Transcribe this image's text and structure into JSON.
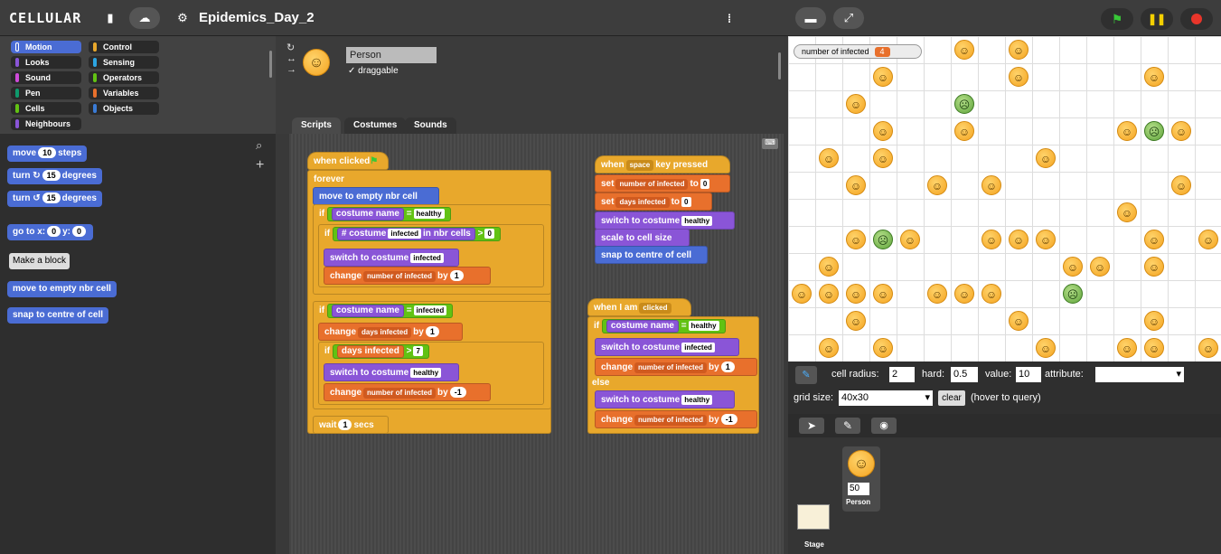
{
  "app": {
    "logo": "CELLULAR",
    "project_title": "Epidemics_Day_2"
  },
  "categories": [
    {
      "label": "Motion",
      "color": "#4a6cd4",
      "selected": true
    },
    {
      "label": "Control",
      "color": "#e8a82c"
    },
    {
      "label": "Looks",
      "color": "#8a55d7"
    },
    {
      "label": "Sensing",
      "color": "#2ca5e2"
    },
    {
      "label": "Sound",
      "color": "#cf4ad9"
    },
    {
      "label": "Operators",
      "color": "#62c213"
    },
    {
      "label": "Pen",
      "color": "#0e9a6c"
    },
    {
      "label": "Variables",
      "color": "#e8702c"
    },
    {
      "label": "Cells",
      "color": "#62c213"
    },
    {
      "label": "Objects",
      "color": "#3a7bd5"
    },
    {
      "label": "Neighbours",
      "color": "#8a55d7"
    }
  ],
  "palette": {
    "move": {
      "a": "move",
      "n": "10",
      "b": "steps"
    },
    "turn_cw": {
      "a": "turn ↻",
      "n": "15",
      "b": "degrees"
    },
    "turn_ccw": {
      "a": "turn ↺",
      "n": "15",
      "b": "degrees"
    },
    "goto": {
      "a": "go to x:",
      "x": "0",
      "b": "y:",
      "y": "0"
    },
    "make_block": "Make a block",
    "move_empty": "move to empty nbr cell",
    "snap": "snap to centre of cell"
  },
  "sprite": {
    "name": "Person",
    "draggable_label": "draggable",
    "draggable_checked": "✓"
  },
  "tabs": {
    "scripts": "Scripts",
    "costumes": "Costumes",
    "sounds": "Sounds"
  },
  "script1": {
    "hat": "when clicked",
    "forever": "forever",
    "move": "move to empty nbr cell",
    "if1": "if",
    "costume_name": "costume name",
    "eq": "=",
    "healthy": "healthy",
    "if2": "if",
    "count": "# costume",
    "infected": "infected",
    "in_nbr": "in nbr cells",
    "gt": ">",
    "zero": "0",
    "switch1": "switch to costume",
    "switch1_val": "infected",
    "change1": "change",
    "change1_var": "number of infected",
    "by": "by",
    "change1_val": "1",
    "if3": "if",
    "infected2": "infected",
    "change2": "change",
    "change2_var": "days infected",
    "change2_val": "1",
    "if4": "if",
    "days_infected": "days infected",
    "gt2": ">",
    "seven": "7",
    "switch2": "switch to costume",
    "switch2_val": "healthy",
    "change3": "change",
    "change3_var": "number of infected",
    "change3_val": "-1",
    "wait": "wait",
    "wait_val": "1",
    "secs": "secs"
  },
  "script2": {
    "hat_a": "when",
    "key": "space",
    "hat_b": "key pressed",
    "set1": "set",
    "set1_var": "number of infected",
    "to": "to",
    "set1_val": "0",
    "set2": "set",
    "set2_var": "days infected",
    "set2_val": "0",
    "switch": "switch to costume",
    "switch_val": "healthy",
    "scale": "scale to cell size",
    "snap": "snap to centre of cell"
  },
  "script3": {
    "hat": "when I am",
    "hat_val": "clicked",
    "if": "if",
    "costume_name": "costume name",
    "eq": "=",
    "healthy": "healthy",
    "switch1": "switch to costume",
    "switch1_val": "infected",
    "change1": "change",
    "change1_var": "number of infected",
    "by": "by",
    "change1_val": "1",
    "else": "else",
    "switch2": "switch to costume",
    "switch2_val": "healthy",
    "change2": "change",
    "change2_var": "number of infected",
    "change2_val": "-1"
  },
  "watcher": {
    "label": "number of infected",
    "value": "4"
  },
  "stage_faces": {
    "healthy_count_shown": "many",
    "infected_icon": "sick-face-icon",
    "healthy_icon": "smiley-face-icon"
  },
  "params": {
    "cell_radius_label": "cell radius:",
    "cell_radius": "2",
    "hard_label": "hard:",
    "hard": "0.5",
    "value_label": "value:",
    "value": "10",
    "attribute_label": "attribute:",
    "attribute": "",
    "grid_size_label": "grid size:",
    "grid_size": "40x30",
    "clear_label": "clear",
    "hover_hint": "(hover to query)"
  },
  "corral": {
    "sprite_count": "50",
    "sprite_name": "Person",
    "stage_label": "Stage"
  }
}
